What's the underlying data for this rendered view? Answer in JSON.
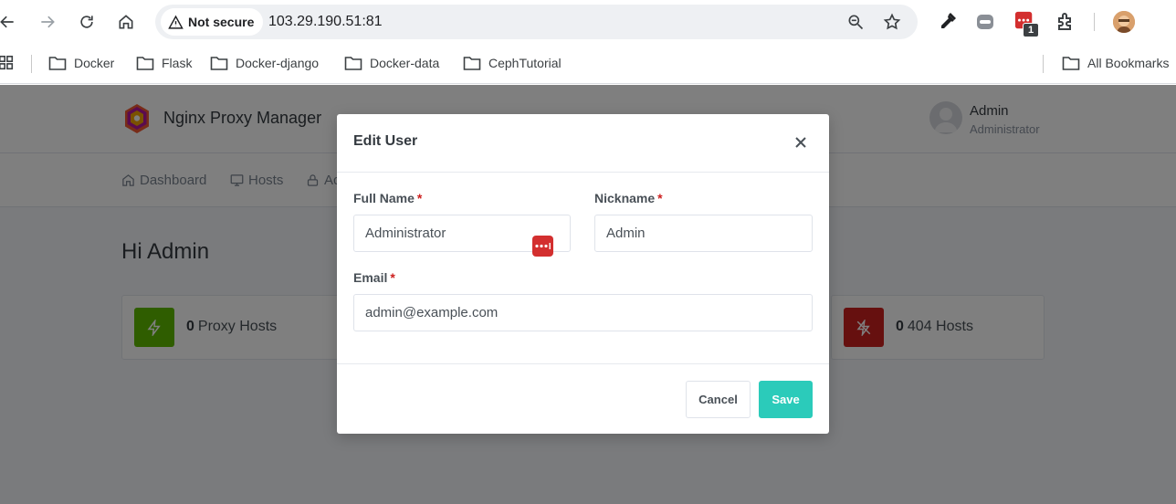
{
  "browser": {
    "security_label": "Not secure",
    "url": "103.29.190.51:81",
    "extension_badge_count": "1",
    "bookmarks": [
      {
        "label": "Docker"
      },
      {
        "label": "Flask"
      },
      {
        "label": "Docker-django"
      },
      {
        "label": "Docker-data"
      },
      {
        "label": "CephTutorial"
      }
    ],
    "all_bookmarks_label": "All Bookmarks"
  },
  "app": {
    "brand": "Nginx Proxy Manager",
    "user": {
      "name": "Admin",
      "role": "Administrator"
    },
    "nav": [
      {
        "label": "Dashboard",
        "icon": "home-icon"
      },
      {
        "label": "Hosts",
        "icon": "monitor-icon"
      },
      {
        "label": "Ac",
        "icon": "lock-icon"
      }
    ],
    "greeting": "Hi Admin",
    "stats": [
      {
        "count": "0",
        "label": "Proxy Hosts",
        "icon": "zap-icon",
        "color": "#5eba00"
      },
      {
        "count": "0",
        "label": "404 Hosts",
        "icon": "zap-off-icon",
        "color": "#cd201f"
      }
    ]
  },
  "modal": {
    "title": "Edit User",
    "fields": {
      "full_name": {
        "label": "Full Name",
        "value": "Administrator"
      },
      "nickname": {
        "label": "Nickname",
        "value": "Admin"
      },
      "email": {
        "label": "Email",
        "value": "admin@example.com"
      }
    },
    "required_marker": "*",
    "cancel_label": "Cancel",
    "save_label": "Save",
    "save_color": "#2bcbba"
  }
}
